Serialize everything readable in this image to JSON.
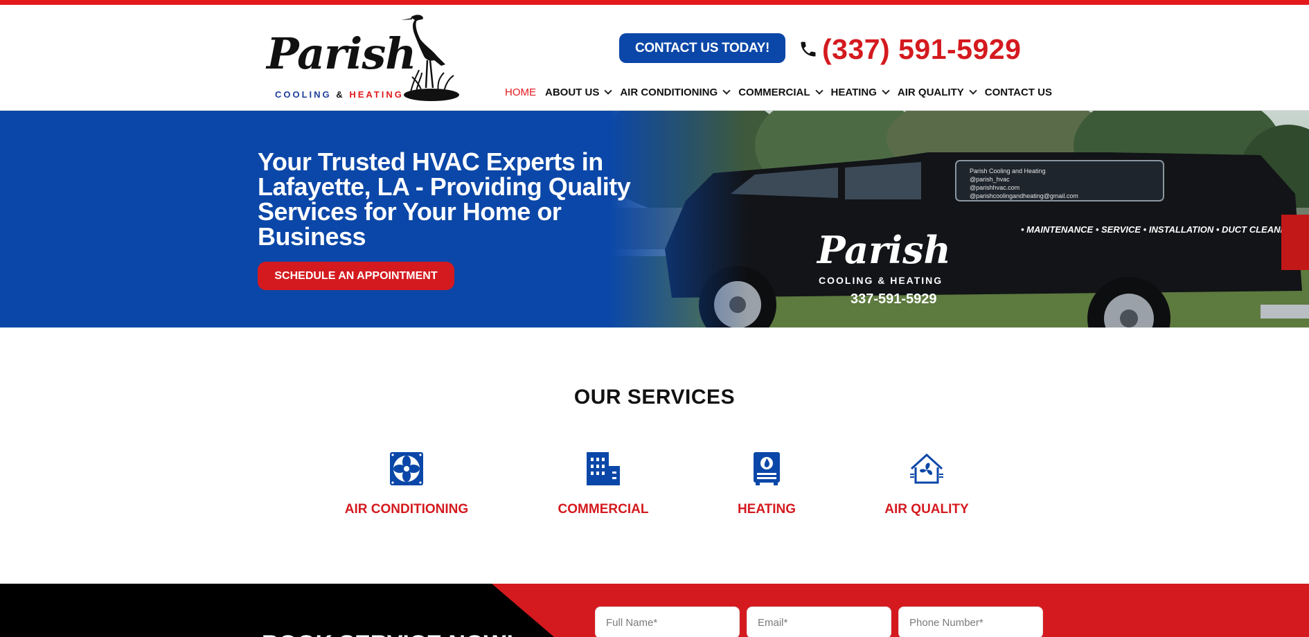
{
  "header": {
    "logo": {
      "script_text": "Parish",
      "sub_cooling": "COOLING",
      "sub_amp": "&",
      "sub_heating": "HEATING"
    },
    "cta_label": "CONTACT US TODAY!",
    "phone": "(337) 591-5929",
    "nav": [
      {
        "label": "HOME",
        "active": true,
        "has_dropdown": false
      },
      {
        "label": "ABOUT US",
        "active": false,
        "has_dropdown": true
      },
      {
        "label": "AIR CONDITIONING",
        "active": false,
        "has_dropdown": true
      },
      {
        "label": "COMMERCIAL",
        "active": false,
        "has_dropdown": true
      },
      {
        "label": "HEATING",
        "active": false,
        "has_dropdown": true
      },
      {
        "label": "AIR QUALITY",
        "active": false,
        "has_dropdown": true
      },
      {
        "label": "CONTACT US",
        "active": false,
        "has_dropdown": false
      }
    ]
  },
  "hero": {
    "title": "Your Trusted HVAC Experts in Lafayette, LA - Providing Quality Services for Your Home or Business",
    "button_label": "SCHEDULE AN APPOINTMENT",
    "truck": {
      "brand": "Parish",
      "sub": "COOLING & HEATING",
      "phone": "337-591-5929",
      "tagline": "• MAINTENANCE • SERVICE • INSTALLATION • DUCT CLEANING",
      "window_lines": [
        "Parish Cooling and Heating",
        "@parish_hvac",
        "@parishhvac.com",
        "@parishcoolingandheating@gmail.com"
      ]
    }
  },
  "services": {
    "title": "OUR SERVICES",
    "items": [
      {
        "label": "AIR CONDITIONING",
        "icon": "fan-icon"
      },
      {
        "label": "COMMERCIAL",
        "icon": "building-icon"
      },
      {
        "label": "HEATING",
        "icon": "furnace-icon"
      },
      {
        "label": "AIR QUALITY",
        "icon": "house-fan-icon"
      }
    ]
  },
  "booking": {
    "title": "BOOK SERVICE NOW!",
    "fields": [
      {
        "placeholder": "Full Name*"
      },
      {
        "placeholder": "Email*"
      },
      {
        "placeholder": "Phone Number*"
      }
    ]
  },
  "colors": {
    "brand_blue": "#0b47a8",
    "brand_red": "#d41a1f",
    "top_bar_red": "#e3191c"
  }
}
